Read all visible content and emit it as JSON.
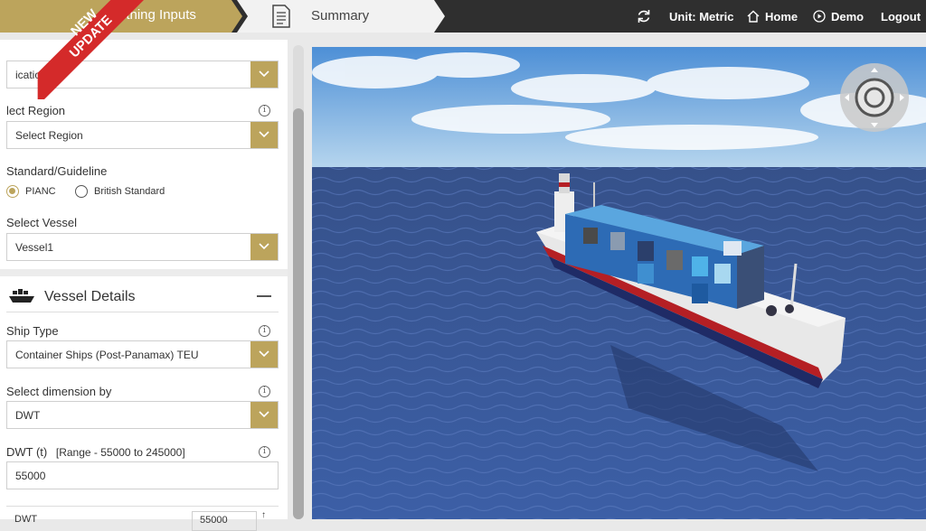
{
  "header": {
    "step_active": "erthing Inputs",
    "step_summary": "Summary",
    "unit": "Unit: Metric",
    "home": "Home",
    "demo": "Demo",
    "logout": "Logout"
  },
  "badge": {
    "line1": "NEW",
    "line2": "UPDATE"
  },
  "project": {
    "location_value": "ication",
    "region_label": "lect Region",
    "region_value": "Select Region",
    "standard_label": "Standard/Guideline",
    "standard_options": [
      "PIANC",
      "British Standard"
    ],
    "standard_selected": "PIANC",
    "vessel_label": "Select Vessel",
    "vessel_value": "Vessel1"
  },
  "vessel_details": {
    "title": "Vessel Details",
    "ship_type_label": "Ship Type",
    "ship_type_value": "Container Ships (Post-Panamax) TEU",
    "dimension_label": "Select dimension by",
    "dimension_value": "DWT",
    "dwt_label": "DWT (t)",
    "dwt_range": "[Range - 55000 to 245000]",
    "dwt_value": "55000",
    "row_label": "DWT",
    "row_value": "55000"
  },
  "colors": {
    "accent": "#bca45c",
    "topbar": "#2f2f2f",
    "badge": "#d42a2a"
  }
}
